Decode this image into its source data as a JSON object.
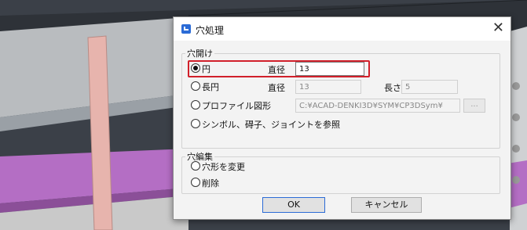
{
  "dialog": {
    "title": "穴処理",
    "close_glyph": "✕"
  },
  "open_group": {
    "legend": "穴開け",
    "circle": {
      "label": "円",
      "diameter_label": "直径",
      "diameter_value": "13",
      "selected": true
    },
    "oval": {
      "label": "長円",
      "diameter_label": "直径",
      "diameter_value": "13",
      "length_label": "長さ",
      "length_value": "5"
    },
    "profile": {
      "label": "プロファイル図形",
      "path_value": "C:¥ACAD-DENKI3D¥SYM¥CP3DSym¥",
      "browse_label": "..."
    },
    "symbol": {
      "label": "シンボル、碍子、ジョイントを参照"
    }
  },
  "edit_group": {
    "legend": "穴編集",
    "change": {
      "label": "穴形を変更"
    },
    "delete": {
      "label": "削除"
    }
  },
  "buttons": {
    "ok": "OK",
    "cancel": "キャンセル"
  },
  "colors": {
    "highlight": "#d1202a",
    "accent": "#2b6bd6",
    "pink_bar": "#e7b4ad",
    "purple_plane": "#b46ec4"
  }
}
